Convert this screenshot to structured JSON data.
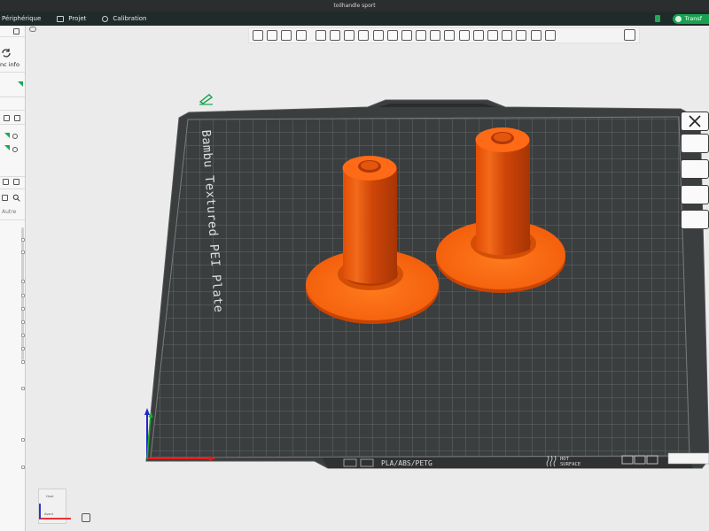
{
  "window": {
    "title": "toilhandle sport"
  },
  "menubar": {
    "items": [
      {
        "label": "Périphérique",
        "icon": "printer-icon"
      },
      {
        "label": "Projet",
        "icon": "project-icon"
      },
      {
        "label": "Calibration",
        "icon": "calibration-icon"
      }
    ],
    "transfer_label": "Transf"
  },
  "left_panel": {
    "sync_label": "nc info",
    "other_label": "Autre"
  },
  "plate": {
    "brand_text": "Bambu Textured PEI Plate",
    "material_text": "PLA/ABS/PETG",
    "hot_text": "HOT",
    "surface_text": "SURFACE"
  },
  "view_cube": {
    "top": "Haut",
    "front": "Avant"
  },
  "colors": {
    "accent": "#17a24f",
    "plate": "#3b3e3f",
    "model": "#f25c0a",
    "background": "#ebebeb"
  },
  "toolbar": {
    "tools": [
      "add-cube-icon",
      "grid-icon",
      "arrange-icon",
      "layers-icon",
      "move-icon",
      "rotate-icon",
      "scale-icon",
      "lay-flat-icon",
      "cut-icon",
      "boolean-icon",
      "support-paint-icon",
      "seam-paint-icon",
      "text-icon",
      "mesh-icon",
      "split-icon",
      "fix-icon",
      "variable-layer-icon",
      "slice-plane-icon",
      "measure-icon",
      "assembly-icon",
      "explode-icon"
    ]
  },
  "side_tools": [
    "close-view-icon",
    "plate-icon",
    "arrange-plate-icon",
    "lock-plate-icon",
    "settings-plate-icon"
  ]
}
